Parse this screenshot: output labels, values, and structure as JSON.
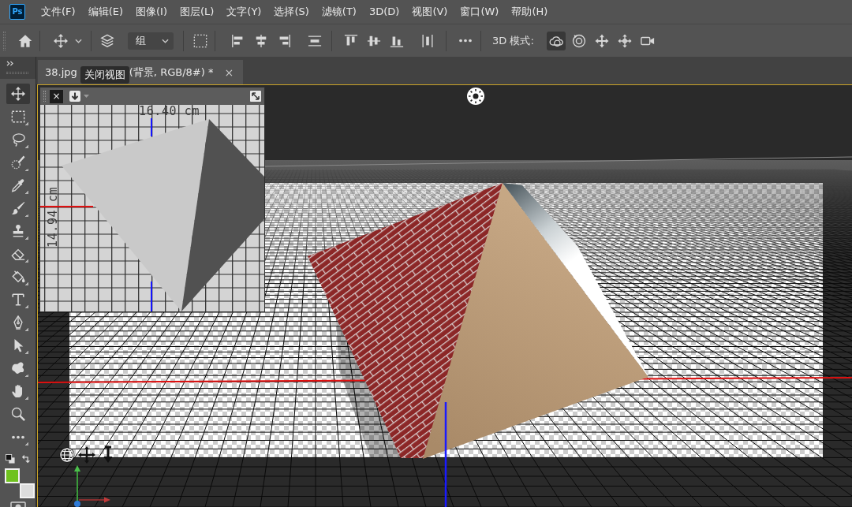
{
  "app": {
    "logo": "Ps"
  },
  "menu_bar": [
    "文件(F)",
    "编辑(E)",
    "图像(I)",
    "图层(L)",
    "文字(Y)",
    "选择(S)",
    "滤镜(T)",
    "3D(D)",
    "视图(V)",
    "窗口(W)",
    "帮助(H)"
  ],
  "options_bar": {
    "dropdown": {
      "value": "组"
    },
    "mode_label": "3D 模式:",
    "mode_tools": [
      {
        "kind": "orbit",
        "selected": true
      },
      {
        "kind": "roll",
        "selected": false
      },
      {
        "kind": "pan",
        "selected": false
      },
      {
        "kind": "slide",
        "selected": false
      },
      {
        "kind": "scale",
        "selected": false
      }
    ]
  },
  "document_tab": {
    "title_start": "38.jpg",
    "title_end": "(背景, RGB/8#) *",
    "close": "×"
  },
  "tooltip": {
    "text": "关闭视图"
  },
  "tools": [
    {
      "kind": "move",
      "selected": true,
      "flyout": false
    },
    {
      "kind": "marquee",
      "selected": false,
      "flyout": true
    },
    {
      "kind": "lasso",
      "selected": false,
      "flyout": true
    },
    {
      "kind": "quick_select",
      "selected": false,
      "flyout": true
    },
    {
      "kind": "eyedropper",
      "selected": false,
      "flyout": true
    },
    {
      "kind": "brush",
      "selected": false,
      "flyout": true
    },
    {
      "kind": "stamp",
      "selected": false,
      "flyout": true
    },
    {
      "kind": "eraser",
      "selected": false,
      "flyout": true
    },
    {
      "kind": "bucket",
      "selected": false,
      "flyout": true
    },
    {
      "kind": "type",
      "selected": false,
      "flyout": true
    },
    {
      "kind": "pen",
      "selected": false,
      "flyout": true
    },
    {
      "kind": "path_select",
      "selected": false,
      "flyout": true
    },
    {
      "kind": "shape",
      "selected": false,
      "flyout": true
    },
    {
      "kind": "hand",
      "selected": false,
      "flyout": true
    },
    {
      "kind": "zoom",
      "selected": false,
      "flyout": false
    },
    {
      "kind": "more",
      "selected": false,
      "flyout": true
    }
  ],
  "color_swatches": [
    {
      "kind": "foreground",
      "color": "#6fc21e"
    },
    {
      "kind": "background",
      "color": "#dcdcdc"
    }
  ],
  "secondary_view": {
    "close": "×",
    "width_label": "16.40 cm",
    "height_label": "14.94 cm"
  }
}
